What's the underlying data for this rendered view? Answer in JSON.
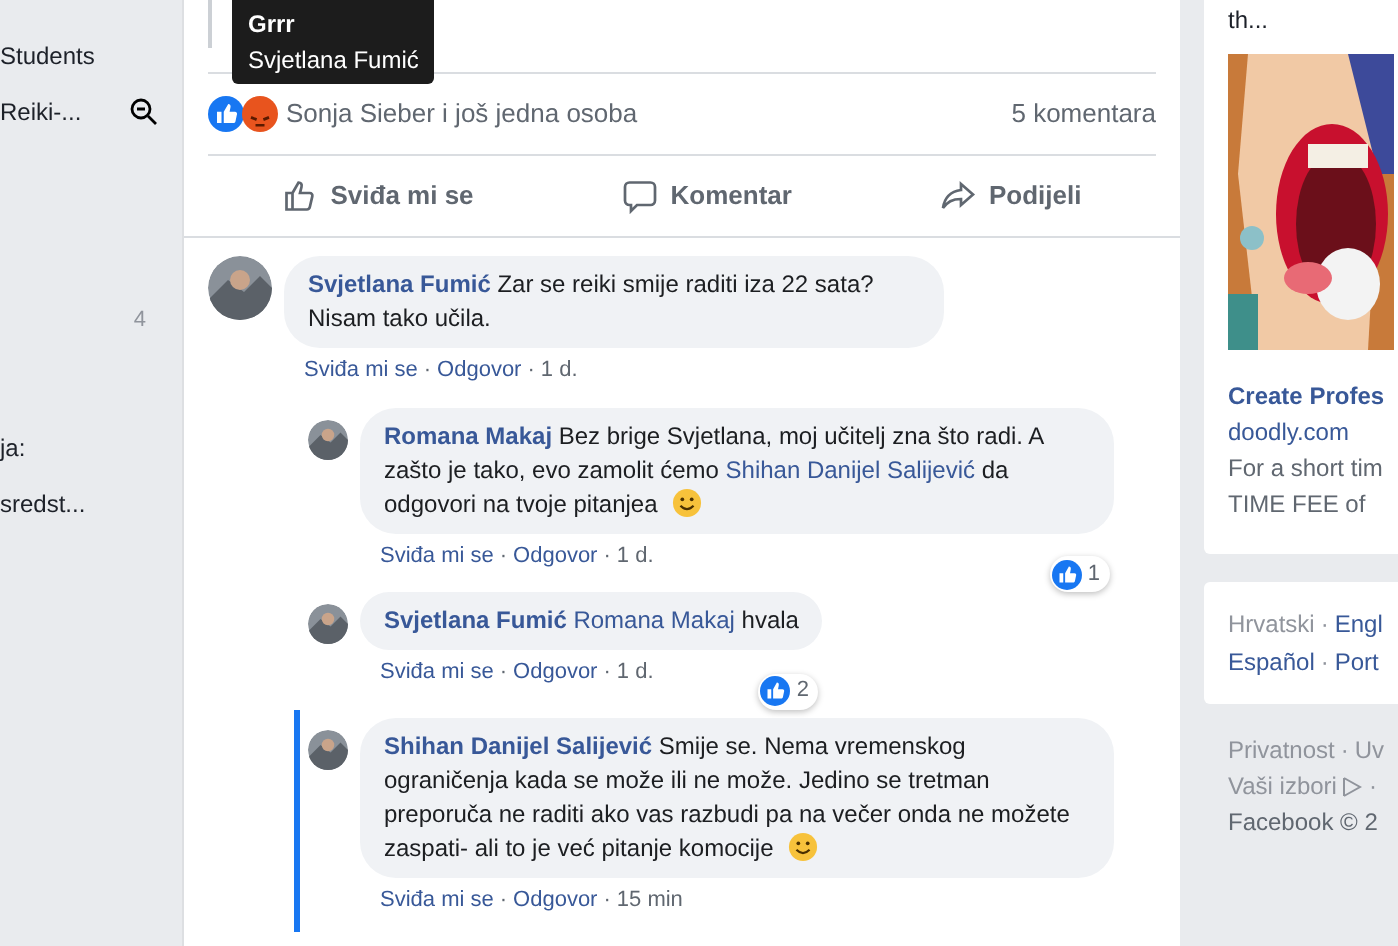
{
  "separator": "·",
  "sidebar": {
    "items": [
      {
        "kind": "label",
        "text": "Students"
      },
      {
        "kind": "search",
        "text": "Reiki-..."
      },
      {
        "kind": "count",
        "text": "4"
      },
      {
        "kind": "label",
        "text": "ja:"
      },
      {
        "kind": "label",
        "text": "sredst..."
      }
    ]
  },
  "tooltip": {
    "title": "Grrr",
    "name": "Svjetlana Fumić"
  },
  "reactions": {
    "summary": "Sonja Sieber i još jedna osoba",
    "comments": "5 komentara"
  },
  "actions": [
    {
      "kind": "like",
      "label": "Sviđa mi se"
    },
    {
      "kind": "comment",
      "label": "Komentar"
    },
    {
      "kind": "share",
      "label": "Podijeli"
    }
  ],
  "comments": [
    {
      "reply": false,
      "highlighted": false,
      "author": "Svjetlana Fumić",
      "body": [
        {
          "kind": "text",
          "text": "Zar se reiki smije raditi iza 22 sata? Nisam tako učila."
        }
      ],
      "meta": [
        "Sviđa mi se",
        "Odgovor",
        "1 d."
      ]
    },
    {
      "reply": true,
      "highlighted": false,
      "author": "Romana Makaj",
      "body": [
        {
          "kind": "text",
          "text": "Bez brige Svjetlana, moj učitelj zna što radi. A zašto je tako, evo zamolit ćemo"
        },
        {
          "kind": "mention",
          "text": "Shihan Danijel Salijević"
        },
        {
          "kind": "text",
          "text": "da odgovori na tvoje pitanjea"
        },
        {
          "kind": "emoji"
        }
      ],
      "likes": "1",
      "meta": [
        "Sviđa mi se",
        "Odgovor",
        "1 d."
      ]
    },
    {
      "reply": true,
      "highlighted": false,
      "author": "Svjetlana Fumić",
      "body": [
        {
          "kind": "mention",
          "text": "Romana Makaj"
        },
        {
          "kind": "text",
          "text": "hvala"
        }
      ],
      "likes": "2",
      "meta": [
        "Sviđa mi se",
        "Odgovor",
        "1 d."
      ]
    },
    {
      "reply": true,
      "highlighted": true,
      "author": "Shihan Danijel Salijević",
      "body": [
        {
          "kind": "text",
          "text": "Smije se. Nema vremenskog ograničenja kada se može ili ne može. Jedino se tretman preporuča ne raditi ako vas razbudi pa na večer onda ne možete zaspati- ali to je već pitanje komocije"
        },
        {
          "kind": "emoji"
        }
      ],
      "meta": [
        "Sviđa mi se",
        "Odgovor",
        "15 min"
      ]
    }
  ],
  "ad": {
    "teaser": "th...",
    "title": "Create Profes",
    "domain": "doodly.com",
    "lines": [
      "For a short tim",
      "TIME FEE of"
    ]
  },
  "languages": [
    [
      "Hrvatski",
      "Engl"
    ],
    [
      "Español",
      "Port"
    ]
  ],
  "footer": {
    "links": [
      "Privatnost",
      "Uv"
    ],
    "choices": "Vaši izbori",
    "copyright": "Facebook © 2"
  }
}
